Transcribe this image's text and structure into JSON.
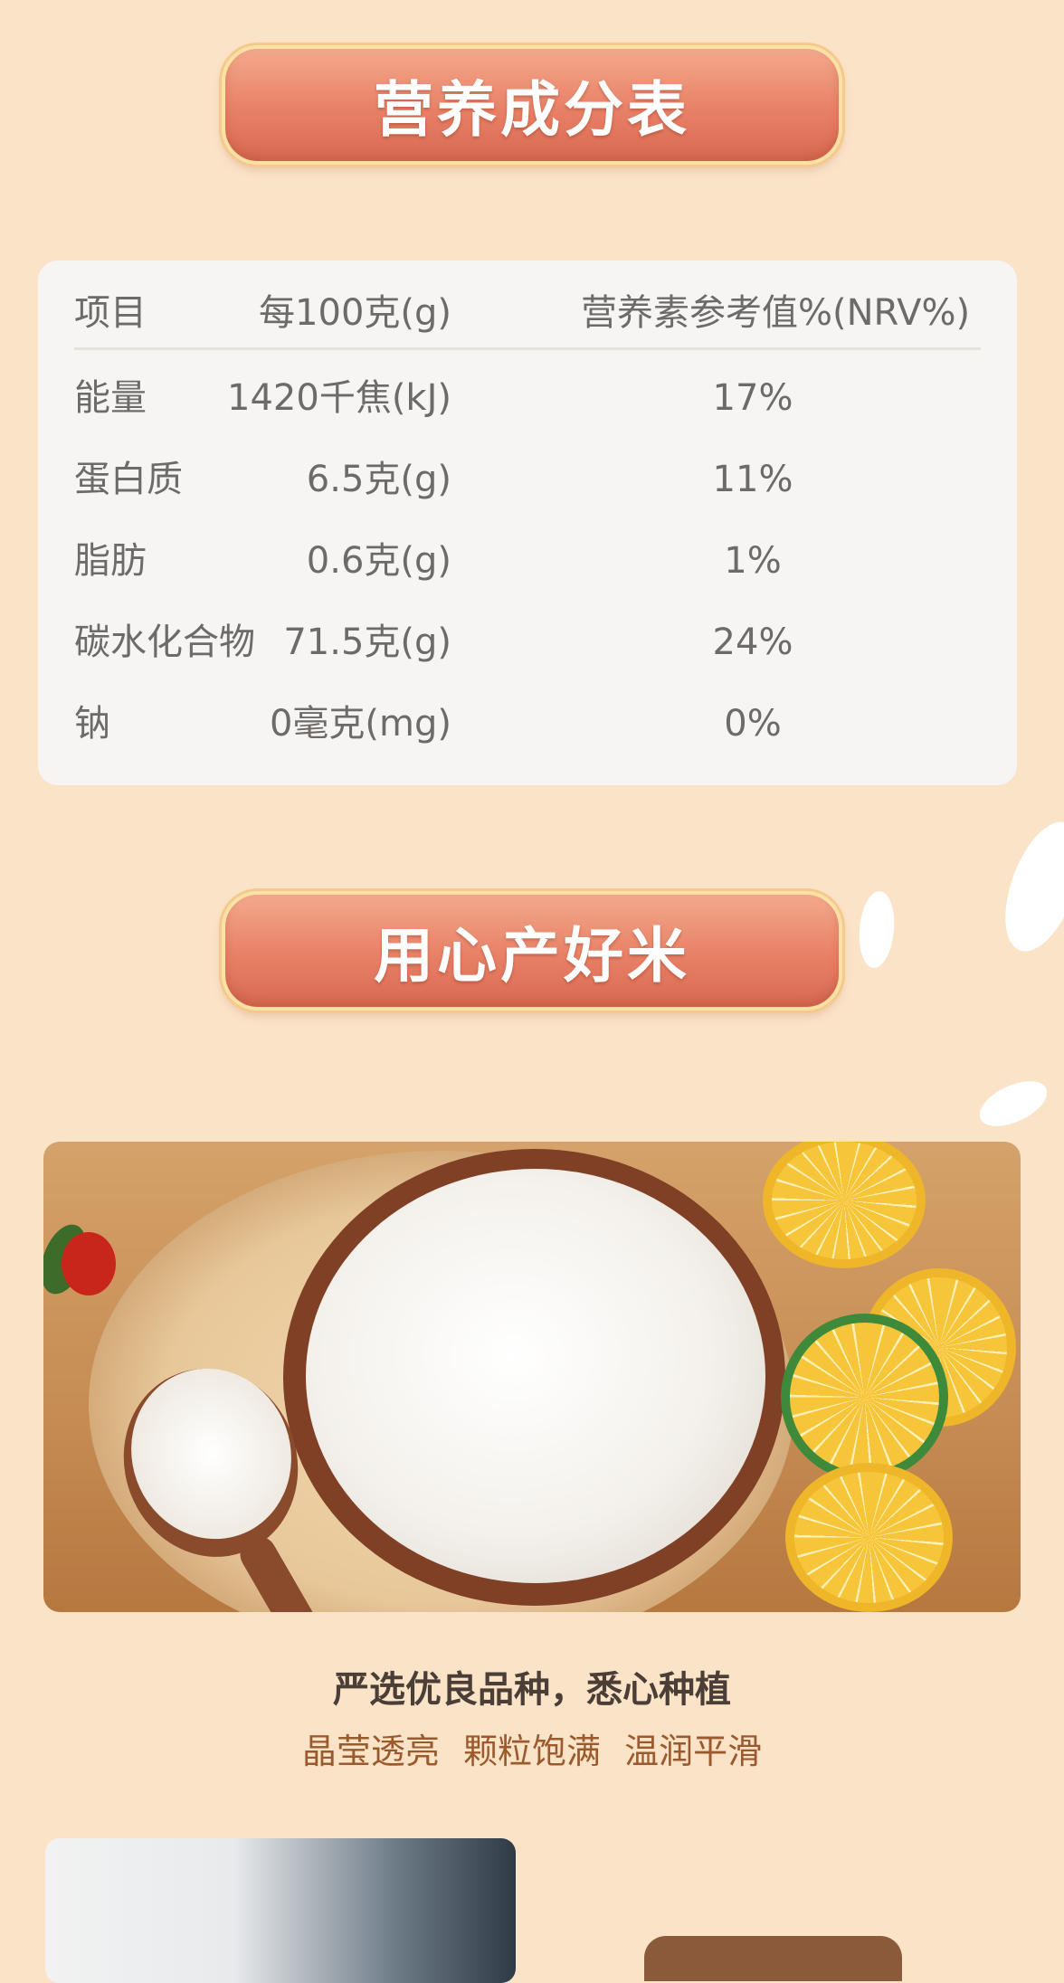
{
  "sections": {
    "nutrition_title": "营养成分表",
    "craft_title": "用心产好米"
  },
  "nutrition": {
    "headers": [
      "项目",
      "每100克(g)",
      "营养素参考值%(NRV%)"
    ],
    "rows": [
      {
        "item": "能量",
        "amount": "1420千焦(kJ)",
        "nrv": "17%"
      },
      {
        "item": "蛋白质",
        "amount": "6.5克(g)",
        "nrv": "11%"
      },
      {
        "item": "脂肪",
        "amount": "0.6克(g)",
        "nrv": "1%"
      },
      {
        "item": "碳水化合物",
        "amount": "71.5克(g)",
        "nrv": "24%"
      },
      {
        "item": "钠",
        "amount": "0毫克(mg)",
        "nrv": "0%"
      }
    ]
  },
  "taglines": {
    "line1": "严选优良品种，悉心种植",
    "line2": "晶莹透亮  颗粒饱满  温润平滑"
  },
  "colors": {
    "background": "#fbe3c8",
    "pill": "#e88066",
    "pill_border": "#fbe1a6",
    "card": "#f7f5f3",
    "table_text": "#6e6a68",
    "tagline_dark": "#4a3e36",
    "tagline_brown": "#9a5a2e"
  }
}
